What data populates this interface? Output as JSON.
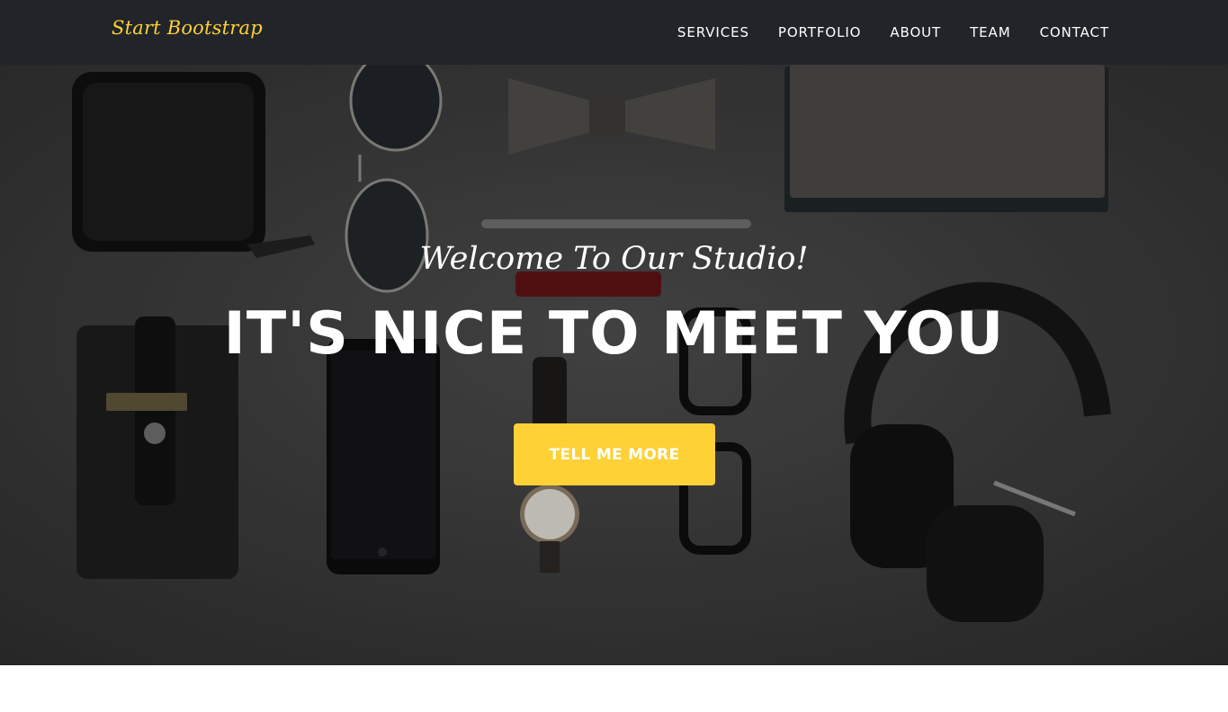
{
  "navbar": {
    "brand": "Start Bootstrap",
    "links": [
      "SERVICES",
      "PORTFOLIO",
      "ABOUT",
      "TEAM",
      "CONTACT"
    ]
  },
  "hero": {
    "subheading": "Welcome To Our Studio!",
    "heading": "IT'S NICE TO MEET YOU",
    "button": "TELL ME MORE"
  },
  "colors": {
    "navbar_bg": "#212529",
    "accent": "#fed136",
    "hero_bg": "#3a3a3b",
    "text": "#ffffff"
  }
}
